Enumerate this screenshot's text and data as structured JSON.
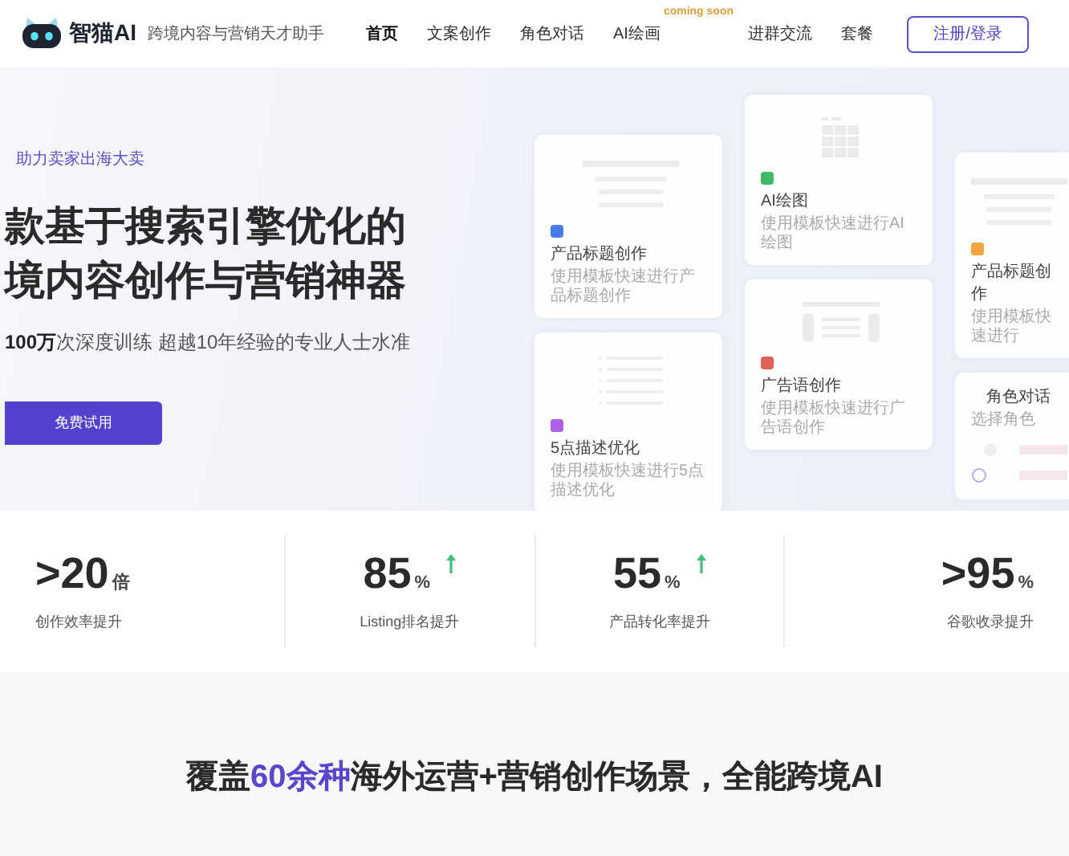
{
  "header": {
    "logo_text": "智猫AI",
    "tagline": "跨境内容与营销天才助手",
    "nav": [
      {
        "label": "首页",
        "selected": true
      },
      {
        "label": "文案创作",
        "selected": false
      },
      {
        "label": "角色对话",
        "selected": false
      },
      {
        "label": "AI绘画",
        "selected": false,
        "badge": "coming soon"
      },
      {
        "label": "进群交流",
        "selected": false
      },
      {
        "label": "套餐",
        "selected": false
      }
    ],
    "login_button": "注册/登录"
  },
  "hero": {
    "tag": "助力卖家出海大卖",
    "headline": [
      "款基于搜索引擎优化的",
      "境内容创作与营销神器"
    ],
    "subtitle": "**100万**次深度训练 超越10年经验的专业人士水准",
    "cta": "免费试用",
    "card_columns": [
      [
        {
          "kind": "lines",
          "color": "#4a7be8",
          "title": "产品标题创作",
          "desc": "使用模板快速进行产品标题创作"
        },
        {
          "kind": "list",
          "color": "#b15ee6",
          "title": "5点描述优化",
          "desc": "使用模板快速进行5点描述优化"
        }
      ],
      [
        {
          "kind": "grid",
          "color": "#3fba6a",
          "title": "AI绘图",
          "desc": "使用模板快速进行AI绘图"
        },
        {
          "kind": "banner",
          "color": "#e0605a",
          "title": "广告语创作",
          "desc": "使用模板快速进行广告语创作"
        }
      ],
      [
        {
          "kind": "lines",
          "color": "#f0a63a",
          "title": "产品标题创作",
          "desc": "使用模板快速进行"
        },
        {
          "kind": "chat",
          "title": "角色对话",
          "desc": "选择角色"
        }
      ]
    ]
  },
  "stats": [
    {
      "value": ">20",
      "unit": "倍",
      "trend_up": false,
      "label": "创作效率提升"
    },
    {
      "value": "85",
      "unit": "%",
      "trend_up": true,
      "label": "Listing排名提升"
    },
    {
      "value": "55",
      "unit": "%",
      "trend_up": true,
      "label": "产品转化率提升"
    },
    {
      "value": ">95",
      "unit": "%",
      "trend_up": false,
      "label": "谷歌收录提升"
    }
  ],
  "section_title": "覆盖**60余种**海外运营+营销创作场景，全能跨境AI"
}
